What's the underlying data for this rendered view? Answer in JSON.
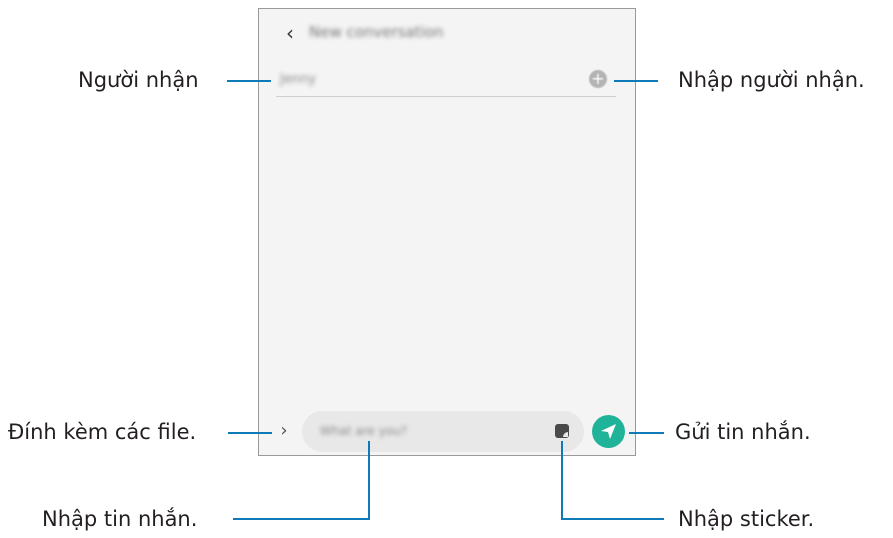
{
  "labels": {
    "recipient": "Người nhận",
    "enter_recipient": "Nhập người nhận.",
    "attach_files": "Đính kèm các file.",
    "send_message": "Gửi tin nhắn.",
    "enter_message": "Nhập tin nhắn.",
    "enter_sticker": "Nhập sticker."
  },
  "screen": {
    "title": "New conversation",
    "recipient_value": "Jenny",
    "message_placeholder": "What are you?"
  },
  "icons": {
    "back": "chevron-left-icon",
    "add_recipient": "plus-circle-icon",
    "attach": "chevron-right-icon",
    "sticker": "sticker-icon",
    "send": "paper-plane-icon"
  },
  "colors": {
    "leader_line": "#0e7bb8",
    "send_button": "#1fb39a"
  }
}
